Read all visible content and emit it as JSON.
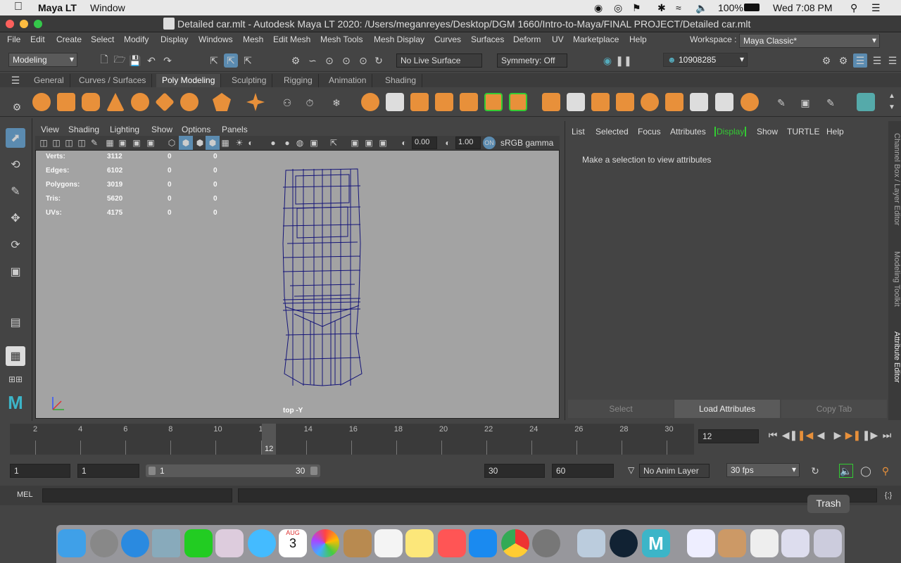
{
  "mac_menu": {
    "app_name": "Maya LT",
    "window_menu": "Window",
    "battery": "100%",
    "clock": "Wed 7:08 PM"
  },
  "title_bar": {
    "title": "Detailed car.mlt - Autodesk Maya LT 2020: /Users/meganreyes/Desktop/DGM 1660/Intro-to-Maya/FINAL PROJECT/Detailed car.mlt"
  },
  "menubar": {
    "items": [
      "File",
      "Edit",
      "Create",
      "Select",
      "Modify",
      "Display",
      "Windows",
      "Mesh",
      "Edit Mesh",
      "Mesh Tools",
      "Mesh Display",
      "Curves",
      "Surfaces",
      "Deform",
      "UV",
      "Marketplace",
      "Help"
    ],
    "workspace_label": "Workspace :",
    "workspace_value": "Maya Classic*"
  },
  "statusline": {
    "menuset": "Modeling",
    "live_surface": "No Live Surface",
    "symmetry": "Symmetry: Off",
    "user_id": "10908285"
  },
  "shelf": {
    "tabs": [
      "General",
      "Curves / Surfaces",
      "Poly Modeling",
      "Sculpting",
      "Rigging",
      "Animation",
      "Shading"
    ],
    "active_tab": "Poly Modeling"
  },
  "viewport": {
    "menu": [
      "View",
      "Shading",
      "Lighting",
      "Show",
      "Options",
      "Panels"
    ],
    "exposure": "0.00",
    "gamma": "1.00",
    "color_space": "sRGB gamma",
    "camera_label": "top -Y",
    "stats": [
      {
        "label": "Verts:",
        "v1": "3112",
        "v2": "0",
        "v3": "0"
      },
      {
        "label": "Edges:",
        "v1": "6102",
        "v2": "0",
        "v3": "0"
      },
      {
        "label": "Polygons:",
        "v1": "3019",
        "v2": "0",
        "v3": "0"
      },
      {
        "label": "Tris:",
        "v1": "5620",
        "v2": "0",
        "v3": "0"
      },
      {
        "label": "UVs:",
        "v1": "4175",
        "v2": "0",
        "v3": "0"
      }
    ]
  },
  "attribute_editor": {
    "menu": [
      "List",
      "Selected",
      "Focus",
      "Attributes",
      "Display",
      "Show",
      "TURTLE",
      "Help"
    ],
    "message": "Make a selection to view attributes",
    "buttons": {
      "select": "Select",
      "load": "Load Attributes",
      "copy": "Copy Tab"
    }
  },
  "side_tabs": [
    "Channel Box / Layer Editor",
    "Modeling Toolkit",
    "Attribute Editor"
  ],
  "timeslider": {
    "ticks": [
      "2",
      "4",
      "6",
      "8",
      "10",
      "12",
      "14",
      "16",
      "18",
      "20",
      "22",
      "24",
      "26",
      "28",
      "30"
    ],
    "current_frame": "12",
    "current_field": "12"
  },
  "range": {
    "start": "1",
    "playback_start": "1",
    "range_start_label": "1",
    "range_end_label": "30",
    "playback_end": "30",
    "end": "60",
    "anim_layer": "No Anim Layer",
    "fps": "30 fps"
  },
  "cmdline": {
    "label": "MEL"
  },
  "dock": {
    "tooltip": "Trash",
    "calendar_month": "AUG",
    "calendar_day": "3"
  }
}
